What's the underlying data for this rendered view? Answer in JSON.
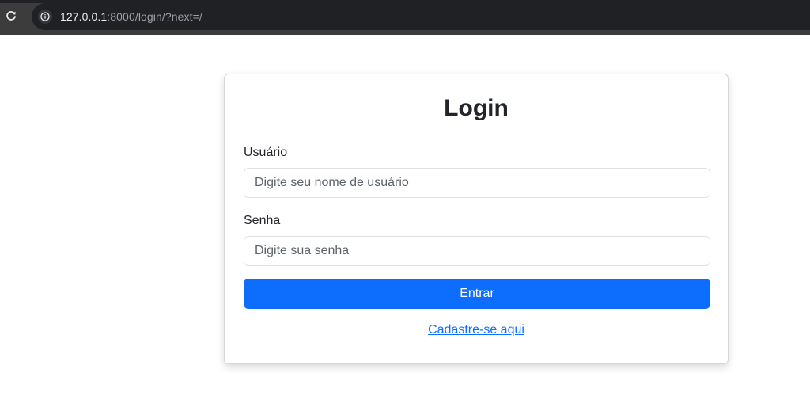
{
  "browser": {
    "url_host": "127.0.0.1",
    "url_rest": ":8000/login/?next=/",
    "icons": {
      "reload": "reload-icon",
      "site_info": "info-icon"
    }
  },
  "login": {
    "title": "Login",
    "username_label": "Usuário",
    "username_placeholder": "Digite seu nome de usuário",
    "username_value": "",
    "password_label": "Senha",
    "password_placeholder": "Digite sua senha",
    "password_value": "",
    "submit_label": "Entrar",
    "register_link": "Cadastre-se aqui"
  },
  "colors": {
    "primary": "#0d6efd",
    "text": "#212529",
    "browser_bar": "#3c3c3c",
    "omnibox": "#202124"
  }
}
